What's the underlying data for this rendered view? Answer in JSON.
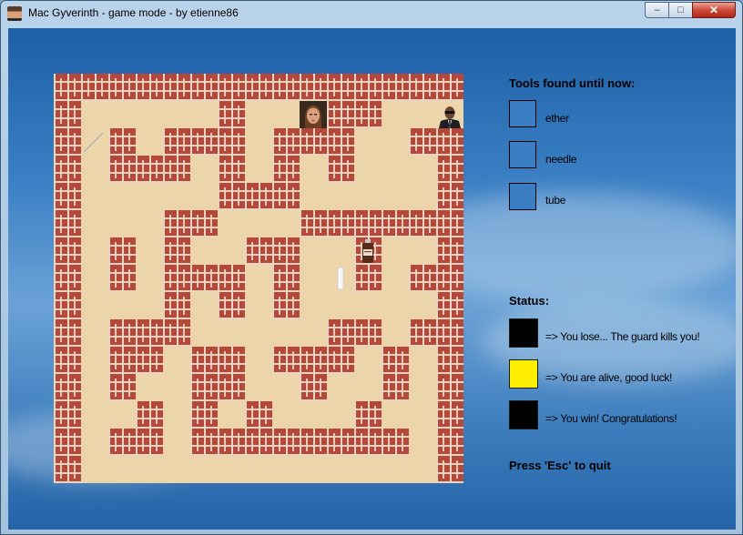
{
  "window": {
    "title": "Mac Gyverinth - game mode - by etienne86",
    "icon": "macgyver-portrait-icon",
    "controls": {
      "minimize": "–",
      "maximize": "□",
      "close": "✕"
    }
  },
  "maze": {
    "grid": [
      "WWWWWWWWWWWWWWW",
      "W.....W...WW..W",
      "W.W.WWW.WWW..WW",
      "W.WWW.W.W.W...W",
      "W.....WWW.....W",
      "W...WW...WWWWWW",
      "W.W.W..WW..W..W",
      "W.W.WWW.W..W.WW",
      "W...W.W.W.....W",
      "W.WWW.....WW.WW",
      "W.WW.WW.WWW.W.W",
      "W.W..WW..W..W.W",
      "W..W.W.W...W..W",
      "W.WW.WWWWWWWW.W",
      "W.............W",
      "WWWWWWWWWWWWWWW"
    ],
    "items": [
      {
        "name": "macgyver",
        "icon": "macgyver-sprite-icon",
        "cell": [
          1,
          9
        ]
      },
      {
        "name": "guardian",
        "icon": "guard-sprite-icon",
        "cell": [
          1,
          14
        ]
      },
      {
        "name": "needle",
        "icon": "needle-icon",
        "cell": [
          2,
          1
        ]
      },
      {
        "name": "ether",
        "icon": "ether-bottle-icon",
        "cell": [
          6,
          11
        ]
      },
      {
        "name": "tube",
        "icon": "tube-icon",
        "cell": [
          7,
          10
        ]
      }
    ]
  },
  "tools": {
    "heading": "Tools found until now:",
    "items": [
      {
        "label": "ether",
        "found": false
      },
      {
        "label": "needle",
        "found": false
      },
      {
        "label": "tube",
        "found": false
      }
    ],
    "box_color": "#3b7ec3"
  },
  "status": {
    "heading": "Status:",
    "items": [
      {
        "label": "=> You lose... The guard kills you!",
        "color": "#000000"
      },
      {
        "label": "=> You are alive, good luck!",
        "color": "#ffee00"
      },
      {
        "label": "=> You win! Congratulations!",
        "color": "#000000"
      }
    ]
  },
  "quit_hint": "Press 'Esc' to quit"
}
